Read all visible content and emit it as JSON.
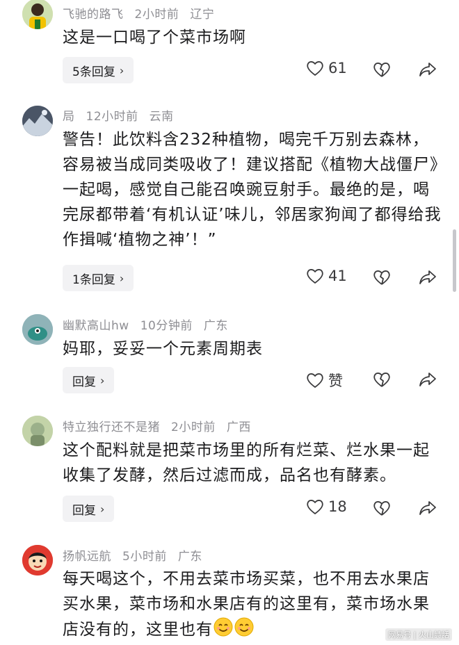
{
  "comments": [
    {
      "user": "飞驰的路飞",
      "time": "2小时前",
      "location": "辽宁",
      "text": "这是一口喝了个菜市场啊",
      "reply_label": "5条回复",
      "likes": "61"
    },
    {
      "user": "局",
      "time": "12小时前",
      "location": "云南",
      "text": "警告！此饮料含232种植物，喝完千万别去森林，容易被当成同类吸收了！建议搭配《植物大战僵尸》一起喝，感觉自己能召唤豌豆射手。最绝的是，喝完尿都带着‘有机认证’味儿，邻居家狗闻了都得给我作揖喊‘植物之神’！”",
      "reply_label": "1条回复",
      "likes": "41"
    },
    {
      "user": "幽默高山hw",
      "time": "10分钟前",
      "location": "广东",
      "text": "妈耶，妥妥一个元素周期表",
      "reply_label": "回复",
      "likes": "赞"
    },
    {
      "user": "特立独行还不是猪",
      "time": "2小时前",
      "location": "广西",
      "text": "这个配料就是把菜市场里的所有烂菜、烂水果一起收集了发酵，然后过滤而成，品名也有酵素。",
      "reply_label": "回复",
      "likes": "18"
    },
    {
      "user": "扬帆远航",
      "time": "5小时前",
      "location": "广东",
      "text": "每天喝这个，不用去菜市场买菜，也不用去水果店买水果，菜市场和水果店有的这里有，菜市场水果店没有的，这里也有",
      "emoji": "smiling-face-emoji"
    }
  ],
  "watermark": "网易号 | 火山詩話",
  "colors": {
    "meta": "#8e8e93",
    "reply_bg": "#f2f2f4"
  }
}
